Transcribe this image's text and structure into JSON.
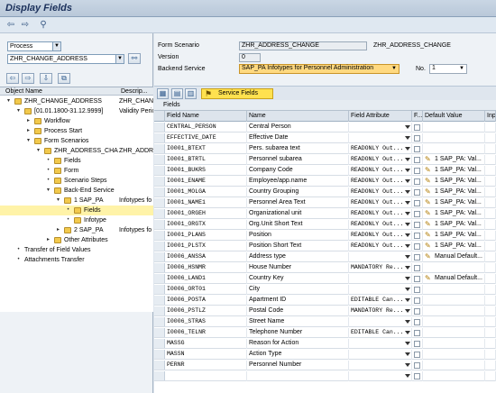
{
  "window": {
    "title": "Display Fields"
  },
  "toolbar": {
    "back": "⇦",
    "forward": "⇨",
    "other": "⚲"
  },
  "left": {
    "type_select": "Process",
    "object_input": "ZHR_CHANGE_ADDRESS",
    "nav_buttons": [
      "⇦",
      "⇨",
      "⇩"
    ],
    "tree_header": {
      "object_name": "Object Name",
      "description": "Descrip..."
    },
    "tree": [
      {
        "label": "ZHR_CHANGE_ADDRESS",
        "desc": "ZHR_CHANG",
        "level": 0,
        "exp": "▾",
        "type": "folder"
      },
      {
        "label": "[01.01.1800-31.12.9999]",
        "desc": "Validity Perio",
        "level": 1,
        "exp": "▾",
        "type": "folder"
      },
      {
        "label": "Workflow",
        "desc": "",
        "level": 2,
        "exp": "▸",
        "type": "folder"
      },
      {
        "label": "Process Start",
        "desc": "",
        "level": 2,
        "exp": "▸",
        "type": "folder"
      },
      {
        "label": "Form Scenarios",
        "desc": "",
        "level": 2,
        "exp": "▾",
        "type": "folder"
      },
      {
        "label": "ZHR_ADDRESS_CHA",
        "desc": "ZHR_ADDRE",
        "level": 3,
        "exp": "▾",
        "type": "folder"
      },
      {
        "label": "Fields",
        "desc": "",
        "level": 4,
        "exp": "•",
        "type": "folder"
      },
      {
        "label": "Form",
        "desc": "",
        "level": 4,
        "exp": "•",
        "type": "folder"
      },
      {
        "label": "Scenario Steps",
        "desc": "",
        "level": 4,
        "exp": "•",
        "type": "folder"
      },
      {
        "label": "Back-End Service",
        "desc": "",
        "level": 4,
        "exp": "▾",
        "type": "folder"
      },
      {
        "label": "1 SAP_PA",
        "desc": "Infotypes fo",
        "level": 5,
        "exp": "▾",
        "type": "folder"
      },
      {
        "label": "Fields",
        "desc": "",
        "level": 6,
        "exp": "•",
        "type": "folder",
        "selected": true
      },
      {
        "label": "Infotype",
        "desc": "",
        "level": 6,
        "exp": "•",
        "type": "folder"
      },
      {
        "label": "2 SAP_PA",
        "desc": "Infotypes fo",
        "level": 5,
        "exp": "▸",
        "type": "folder"
      },
      {
        "label": "Other Attributes",
        "desc": "",
        "level": 4,
        "exp": "▸",
        "type": "folder"
      },
      {
        "label": "Transfer of Field Values",
        "desc": "",
        "level": 1,
        "exp": "•",
        "type": "none"
      },
      {
        "label": "Attachments Transfer",
        "desc": "",
        "level": 1,
        "exp": "•",
        "type": "none"
      }
    ]
  },
  "form": {
    "scenario_label": "Form Scenario",
    "scenario_value": "ZHR_ADDRESS_CHANGE",
    "scenario_desc": "ZHR_ADDRESS_CHANGE",
    "version_label": "Version",
    "version_value": "0",
    "backend_label": "Backend Service",
    "backend_value": "SAP_PA Infotypes for Personnel Administration",
    "no_label": "No.",
    "no_value": "1"
  },
  "tabs": {
    "service_fields_button": "Service Fields"
  },
  "grid": {
    "title": "Fields",
    "columns": [
      "Field Name",
      "Name",
      "Field Attribute",
      "F...",
      "Default Value",
      "Inpu"
    ],
    "rows": [
      {
        "field": "CENTRAL_PERSON",
        "name": "Central Person",
        "attr": "",
        "dv": ""
      },
      {
        "field": "EFFECTIVE_DATE",
        "name": "Effective Date",
        "attr": "",
        "dv": ""
      },
      {
        "field": "I0001_BTEXT",
        "name": "Pers. subarea text",
        "attr": "READONLY Out...",
        "dv": ""
      },
      {
        "field": "I0001_BTRTL",
        "name": "Personnel subarea",
        "attr": "READONLY Out...",
        "dv": "1 SAP_PA: Val..."
      },
      {
        "field": "I0001_BUKRS",
        "name": "Company Code",
        "attr": "READONLY Out...",
        "dv": "1 SAP_PA: Val..."
      },
      {
        "field": "I0001_ENAME",
        "name": "Employee/app.name",
        "attr": "READONLY Out...",
        "dv": "1 SAP_PA: Val..."
      },
      {
        "field": "I0001_MOLGA",
        "name": "Country Grouping",
        "attr": "READONLY Out...",
        "dv": "1 SAP_PA: Val..."
      },
      {
        "field": "I0001_NAME1",
        "name": "Personnel Area Text",
        "attr": "READONLY Out...",
        "dv": "1 SAP_PA: Val..."
      },
      {
        "field": "I0001_ORGEH",
        "name": "Organizational unit",
        "attr": "READONLY Out...",
        "dv": "1 SAP_PA: Val..."
      },
      {
        "field": "I0001_ORGTX",
        "name": "Org.Unit Short Text",
        "attr": "READONLY Out...",
        "dv": "1 SAP_PA: Val..."
      },
      {
        "field": "I0001_PLANS",
        "name": "Position",
        "attr": "READONLY Out...",
        "dv": "1 SAP_PA: Val..."
      },
      {
        "field": "I0001_PLSTX",
        "name": "Position Short Text",
        "attr": "READONLY Out...",
        "dv": "1 SAP_PA: Val..."
      },
      {
        "field": "I0006_ANSSA",
        "name": "Address type",
        "attr": "",
        "dv": "Manual Default..."
      },
      {
        "field": "I0006_HSNMR",
        "name": "House Number",
        "attr": "MANDATORY Re...",
        "dv": ""
      },
      {
        "field": "I0006_LAND1",
        "name": "Country Key",
        "attr": "",
        "dv": "Manual Default..."
      },
      {
        "field": "I0006_ORT01",
        "name": "City",
        "attr": "",
        "dv": ""
      },
      {
        "field": "I0006_POSTA",
        "name": "Apartment ID",
        "attr": "EDITABLE Can...",
        "dv": ""
      },
      {
        "field": "I0006_PSTLZ",
        "name": "Postal Code",
        "attr": "MANDATORY Re...",
        "dv": ""
      },
      {
        "field": "I0006_STRAS",
        "name": "Street Name",
        "attr": "",
        "dv": ""
      },
      {
        "field": "I0006_TELNR",
        "name": "Telephone Number",
        "attr": "EDITABLE Can...",
        "dv": ""
      },
      {
        "field": "MASSG",
        "name": "Reason for Action",
        "attr": "",
        "dv": ""
      },
      {
        "field": "MASSN",
        "name": "Action Type",
        "attr": "",
        "dv": ""
      },
      {
        "field": "PERNR",
        "name": "Personnel Number",
        "attr": "",
        "dv": ""
      },
      {
        "field": "",
        "name": "",
        "attr": "",
        "dv": ""
      }
    ]
  },
  "colors": {
    "selected": "#fff3a8",
    "highlight": "#ffd980",
    "button": "#ffe14f"
  }
}
